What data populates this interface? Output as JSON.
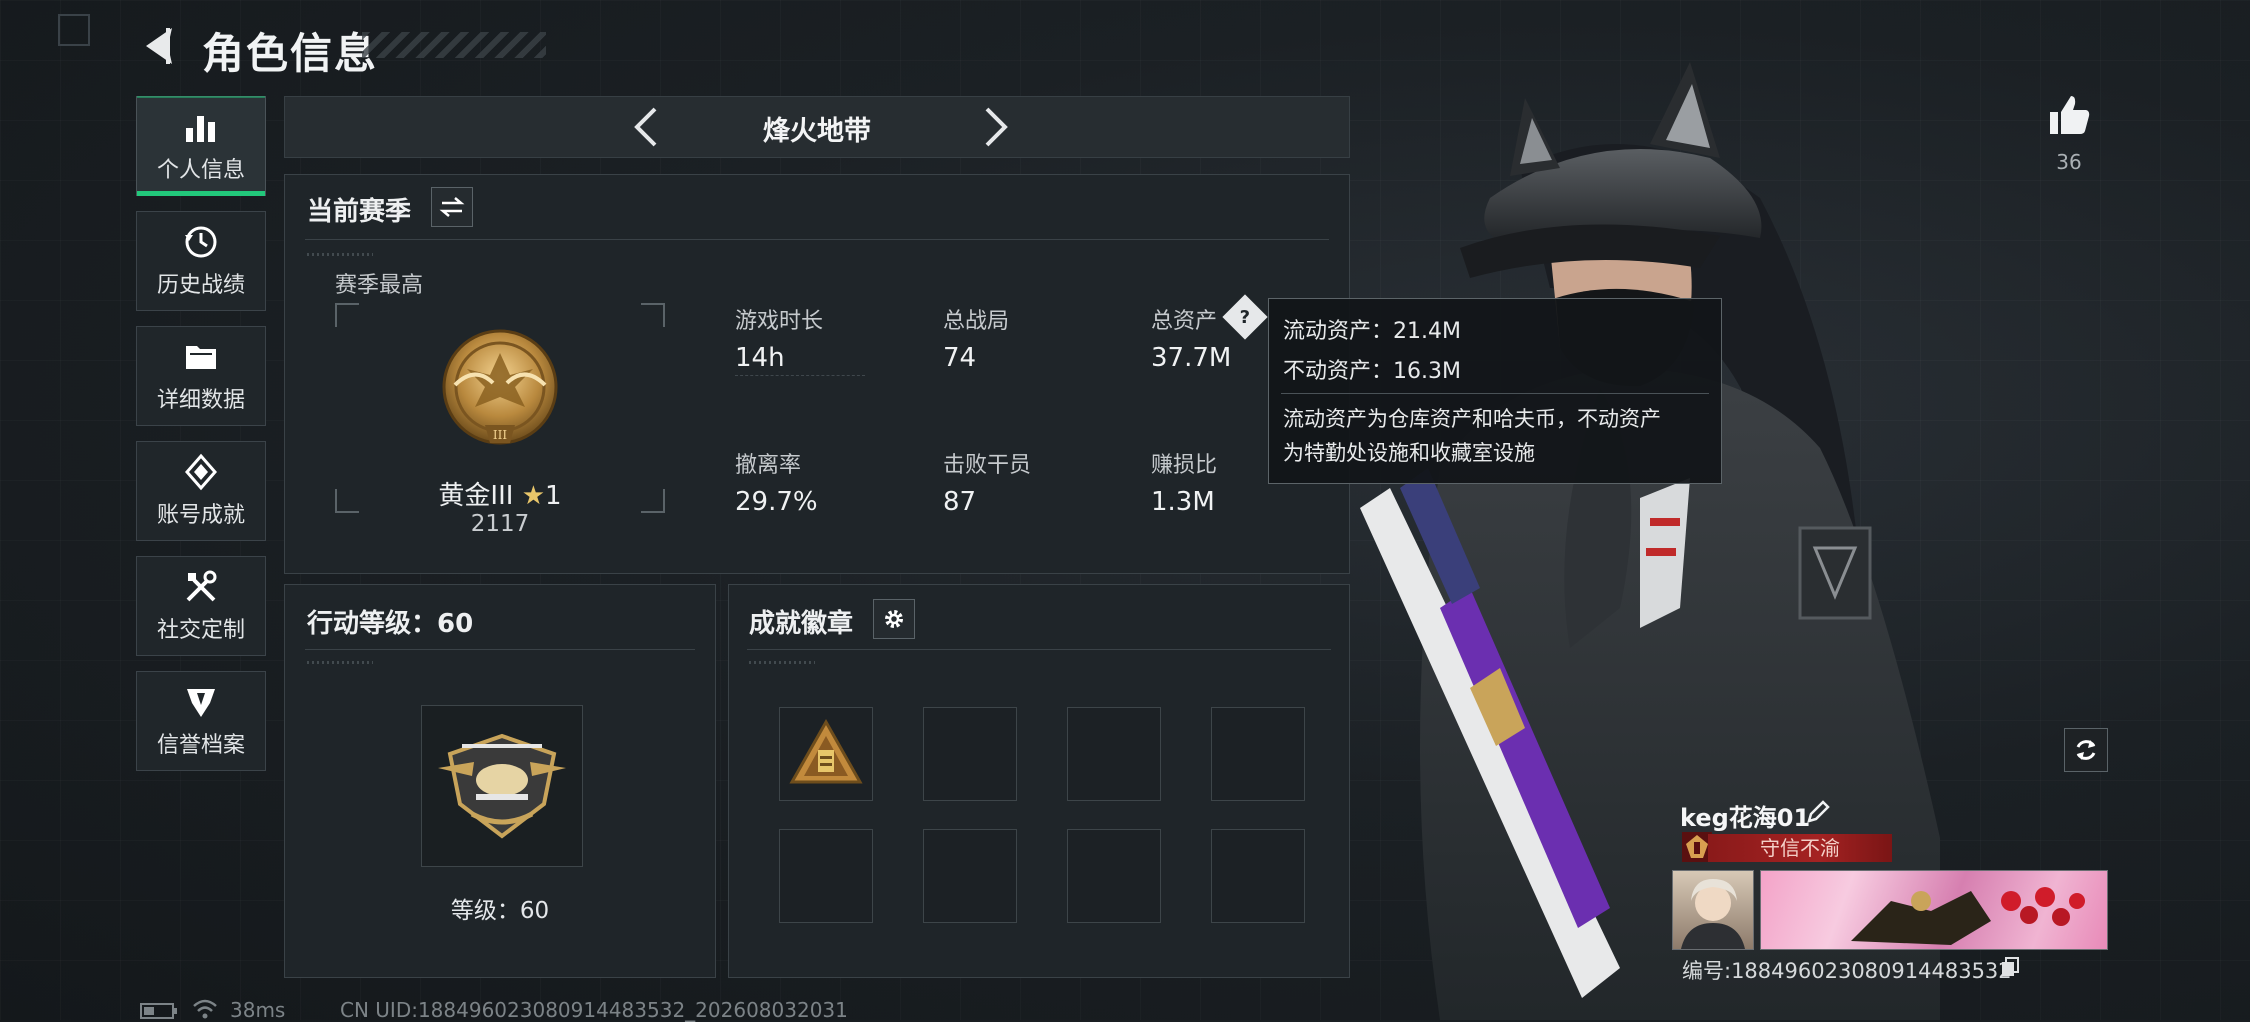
{
  "header": {
    "title": "角色信息"
  },
  "nav": {
    "items": [
      {
        "label": "个人信息",
        "icon": "bar-chart-icon",
        "active": true
      },
      {
        "label": "历史战绩",
        "icon": "history-icon",
        "active": false
      },
      {
        "label": "详细数据",
        "icon": "folder-icon",
        "active": false
      },
      {
        "label": "账号成就",
        "icon": "achievement-icon",
        "active": false
      },
      {
        "label": "社交定制",
        "icon": "tools-icon",
        "active": false
      },
      {
        "label": "信誉档案",
        "icon": "shield-emblem-icon",
        "active": false
      }
    ]
  },
  "mode": {
    "title": "烽火地带"
  },
  "season": {
    "title": "当前赛季",
    "best_label": "赛季最高",
    "rank_name": "黄金III",
    "rank_stars": "1",
    "rank_score": "2117",
    "stats": [
      {
        "label": "游戏时长",
        "value": "14h"
      },
      {
        "label": "总战局",
        "value": "74"
      },
      {
        "label": "总资产",
        "value": "37.7M"
      },
      {
        "label": "撤离率",
        "value": "29.7%"
      },
      {
        "label": "击败干员",
        "value": "87"
      },
      {
        "label": "赚损比",
        "value": "1.3M"
      }
    ]
  },
  "tooltip": {
    "liquid": "流动资产：21.4M",
    "fixed": "不动资产：16.3M",
    "desc_line1": "流动资产为仓库资产和哈夫币，不动资产",
    "desc_line2": "为特勤处设施和收藏室设施"
  },
  "level": {
    "title": "行动等级：60",
    "label": "等级：60"
  },
  "badges": {
    "title": "成就徽章",
    "slots": 8
  },
  "player": {
    "likes": "36",
    "name": "keg花海01",
    "honor": "守信不渝",
    "id": "编号:18849602308091448353​2"
  },
  "status": {
    "ping": "38ms",
    "uid": "CN UID:18849602308091448353​2_202608032031"
  },
  "colors": {
    "accent": "#22c87b",
    "panel": "#1f2529",
    "honor_red": "#a42222",
    "gold": "#c9a45a"
  }
}
